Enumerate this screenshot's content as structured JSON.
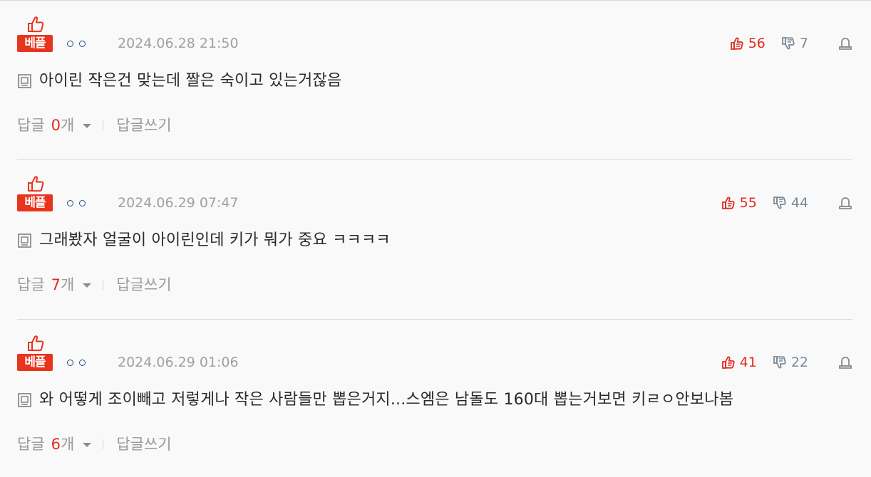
{
  "comments": [
    {
      "badge": "베플",
      "date": "2024.06.28 21:50",
      "likes": "56",
      "dislikes": "7",
      "text": "아이린 작은건 맞는데 짤은 숙이고 있는거잖음",
      "reply_label": "답글",
      "reply_count": "0",
      "reply_unit": "개",
      "write_reply": "답글쓰기"
    },
    {
      "badge": "베플",
      "date": "2024.06.29 07:47",
      "likes": "55",
      "dislikes": "44",
      "text": "그래봤자 얼굴이 아이린인데 키가 뭐가 중요 ㅋㅋㅋㅋ",
      "reply_label": "답글",
      "reply_count": "7",
      "reply_unit": "개",
      "write_reply": "답글쓰기"
    },
    {
      "badge": "베플",
      "date": "2024.06.29 01:06",
      "likes": "41",
      "dislikes": "22",
      "text": "와 어떻게 조이빼고 저렇게나 작은 사람들만 뽑은거지...스엠은 남돌도 160대 뽑는거보면 키ㄹㅇ안보나봄",
      "reply_label": "답글",
      "reply_count": "6",
      "reply_unit": "개",
      "write_reply": "답글쓰기"
    }
  ],
  "icons": {
    "badge_thumb": "thumbs-up-icon",
    "like": "thumbs-up-icon",
    "dislike": "thumbs-down-icon",
    "report": "report-icon",
    "comment_mark": "memo-icon",
    "reply_caret": "caret-down-icon"
  },
  "colors": {
    "badge_bg": "#e8341c",
    "like": "#e02b1f",
    "dislike": "#7b8a98",
    "reply_count": "#e02b1f",
    "nick_dots": "#2a4a8a"
  }
}
